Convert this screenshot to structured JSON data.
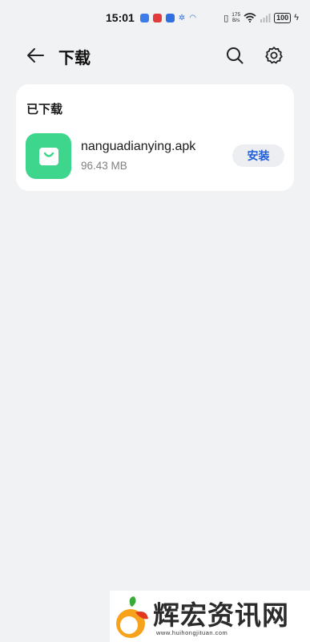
{
  "status_bar": {
    "time": "15:01",
    "net_speed_value": "175",
    "net_speed_unit": "B/s",
    "battery": "100"
  },
  "header": {
    "title": "下载"
  },
  "downloaded_section": {
    "title": "已下载",
    "files": [
      {
        "name": "nanguadianying.apk",
        "size": "96.43 MB",
        "action_label": "安装",
        "icon": "shopping-bag-icon",
        "icon_color": "#3dd68c"
      }
    ]
  },
  "watermark": {
    "text": "辉宏资讯网",
    "url": "www.huihongjituan.com"
  },
  "colors": {
    "background": "#f1f2f4",
    "card": "#ffffff",
    "accent": "#1f5ed6",
    "app_icon": "#3dd68c"
  }
}
